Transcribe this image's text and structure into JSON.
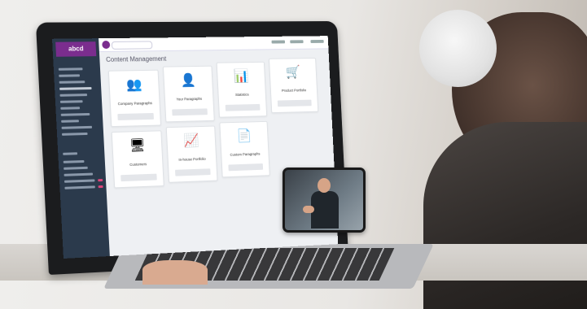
{
  "scene": {
    "app": {
      "logo_text": "abcd",
      "page_title": "Content Management",
      "cards": [
        {
          "label": "Company Paragraphs",
          "icon": "people-icon",
          "glyph": "👥"
        },
        {
          "label": "Your Paragraphs",
          "icon": "person-icon",
          "glyph": "👤"
        },
        {
          "label": "Statistics",
          "icon": "bar-chart-icon",
          "glyph": "📊"
        },
        {
          "label": "Product Portfolio",
          "icon": "cart-icon",
          "glyph": "🛒"
        },
        {
          "label": "Customers",
          "icon": "monitor-icon",
          "glyph": "🖥"
        },
        {
          "label": "In-house Portfolio",
          "icon": "presentation-icon",
          "glyph": "📈"
        },
        {
          "label": "Custom Paragraphs",
          "icon": "document-icon",
          "glyph": "📄"
        }
      ]
    }
  }
}
